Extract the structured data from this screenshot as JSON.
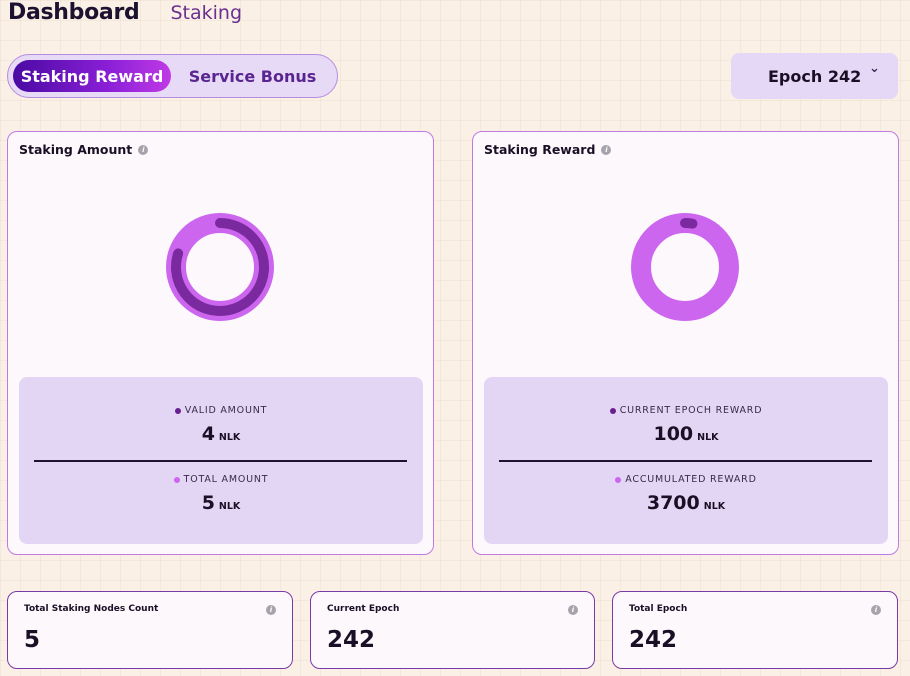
{
  "header": {
    "title": "Dashboard",
    "breadcrumb": "Staking"
  },
  "tabs": [
    {
      "label": "Staking Reward",
      "active": true
    },
    {
      "label": "Service Bonus",
      "active": false
    }
  ],
  "epoch_select": {
    "label": "Epoch 242",
    "icon": "chevron-down-icon"
  },
  "staking_amount": {
    "title": "Staking Amount",
    "valid": {
      "label": "VALID AMOUNT",
      "value": "4",
      "unit": "NLK",
      "color": "#6a1f8f"
    },
    "total": {
      "label": "TOTAL AMOUNT",
      "value": "5",
      "unit": "NLK",
      "color": "#cc66ee"
    },
    "ratio": 0.8
  },
  "staking_reward": {
    "title": "Staking Reward",
    "current": {
      "label": "CURRENT EPOCH REWARD",
      "value": "100",
      "unit": "NLK",
      "color": "#6a1f8f"
    },
    "accumulated": {
      "label": "ACCUMULATED REWARD",
      "value": "3700",
      "unit": "NLK",
      "color": "#cc66ee"
    },
    "ratio": 0.027
  },
  "summary": [
    {
      "label": "Total Staking Nodes Count",
      "value": "5"
    },
    {
      "label": "Current Epoch",
      "value": "242"
    },
    {
      "label": "Total Epoch",
      "value": "242"
    }
  ],
  "colors": {
    "accent_dark": "#6a1f8f",
    "accent_light": "#cc66ee",
    "background": "#faf0e6"
  }
}
